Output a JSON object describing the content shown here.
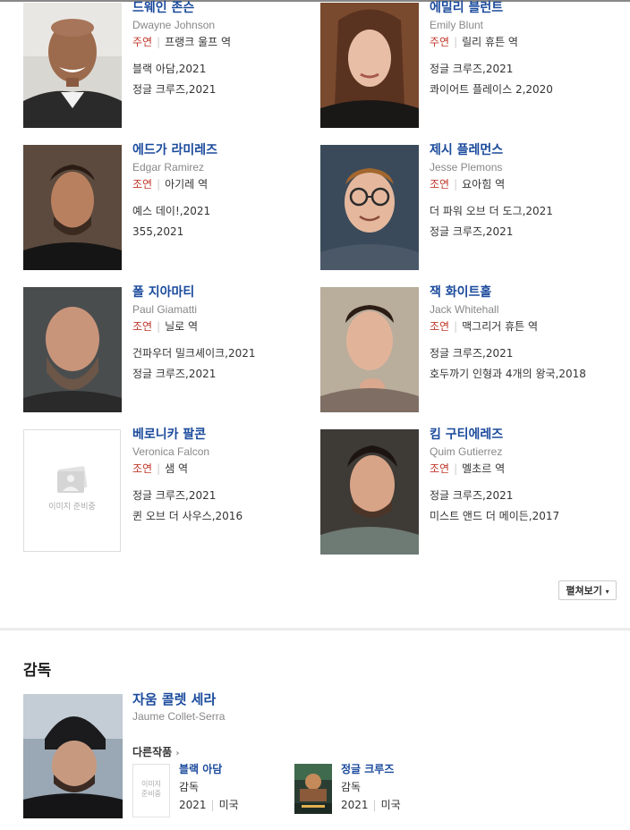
{
  "cast": [
    {
      "name_ko": "드웨인 존슨",
      "name_en": "Dwayne Johnson",
      "role_type": "주연",
      "role": "프랭크 울프 역",
      "works": [
        "블랙 아담,2021",
        "정글 크루즈,2021"
      ],
      "photo": "Dwayne Johnson portrait"
    },
    {
      "name_ko": "에밀리 블런트",
      "name_en": "Emily Blunt",
      "role_type": "주연",
      "role": "릴리 휴튼 역",
      "works": [
        "정글 크루즈,2021",
        "콰이어트 플레이스 2,2020"
      ],
      "photo": "Emily Blunt portrait"
    },
    {
      "name_ko": "에드가 라미레즈",
      "name_en": "Edgar Ramirez",
      "role_type": "조연",
      "role": "아기레 역",
      "works": [
        "예스 데이!,2021",
        "355,2021"
      ],
      "photo": "Edgar Ramirez portrait"
    },
    {
      "name_ko": "제시 플레먼스",
      "name_en": "Jesse Plemons",
      "role_type": "조연",
      "role": "요아힘 역",
      "works": [
        "더 파워 오브 더 도그,2021",
        "정글 크루즈,2021"
      ],
      "photo": "Jesse Plemons portrait"
    },
    {
      "name_ko": "폴 지아마티",
      "name_en": "Paul Giamatti",
      "role_type": "조연",
      "role": "닐로 역",
      "works": [
        "건파우더 밀크셰이크,2021",
        "정글 크루즈,2021"
      ],
      "photo": "Paul Giamatti portrait"
    },
    {
      "name_ko": "잭 화이트홀",
      "name_en": "Jack Whitehall",
      "role_type": "조연",
      "role": "맥그리거 휴튼 역",
      "works": [
        "정글 크루즈,2021",
        "호두까기 인형과 4개의 왕국,2018"
      ],
      "photo": "Jack Whitehall portrait"
    },
    {
      "name_ko": "베로니카 팔콘",
      "name_en": "Veronica Falcon",
      "role_type": "조연",
      "role": "샘 역",
      "works": [
        "정글 크루즈,2021",
        "퀸 오브 더 사우스,2016"
      ],
      "photo": "placeholder",
      "placeholder_text": "이미지 준비중"
    },
    {
      "name_ko": "킴 구티에레즈",
      "name_en": "Quim Gutierrez",
      "role_type": "조연",
      "role": "멜초르 역",
      "works": [
        "정글 크루즈,2021",
        "미스트 앤드 더 메이든,2017"
      ],
      "photo": "Quim Gutierrez portrait"
    }
  ],
  "more_button": {
    "label": "펼쳐보기",
    "icon": "caret-down-icon"
  },
  "director_section": {
    "title": "감독",
    "name_ko": "자움 콜렛 세라",
    "name_en": "Jaume Collet-Serra",
    "other_works_label": "다른작품",
    "works": [
      {
        "title": "블랙 아담",
        "role": "감독",
        "year": "2021",
        "country": "미국",
        "poster": "placeholder",
        "placeholder_text_1": "이미지",
        "placeholder_text_2": "준비중"
      },
      {
        "title": "정글 크루즈",
        "role": "감독",
        "year": "2021",
        "country": "미국",
        "poster": "Jungle Cruise poster"
      }
    ]
  },
  "colors": {
    "link_blue": "#1a4a9c",
    "role_red": "#c0392b",
    "muted": "#888888"
  }
}
